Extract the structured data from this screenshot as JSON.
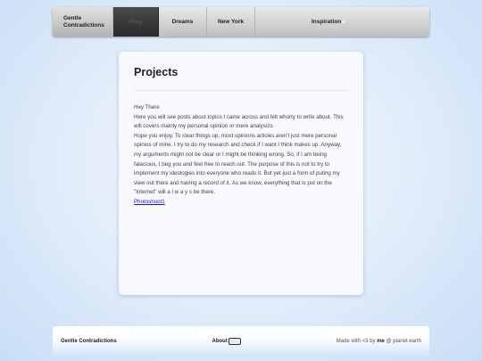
{
  "nav": {
    "brand_line1": "Gentle",
    "brand_line2": "Contradictions",
    "items": [
      {
        "label": "Blog"
      },
      {
        "label": "Dreams"
      },
      {
        "label": "New York"
      },
      {
        "label": "Inspiration"
      }
    ],
    "inspiration_suffix": "s"
  },
  "main": {
    "title": "Projects",
    "paragraphs": [
      "Hey There",
      "Here you will see posts about topics I came across and felt whorty to write about. This will covers mainly my personal opinion or mere analysizs.",
      "Hope you enjoy. To clear things up, most opinions articles aren't just mere personal opinios of mine. I try to do my research and check if I want I think makes up. Anyway, my arguments might not be clear or I might be thinking wrong. So, if I am being falacious, I beg you and feel free to reach out. The purpose of this is not to try to implement my ideologies into everyone who reads it. But yet just a form of puting my view out there and having a record of it. As we know, everything that is put on the \"Internet\" will a l w a y s be there."
    ],
    "link": "Photoshoot1"
  },
  "footer": {
    "brand": "Gentle Contradictions",
    "about": "About",
    "credit_prefix": "Made with <3 by ",
    "credit_name": "me",
    "credit_suffix": " @ planet earth"
  }
}
